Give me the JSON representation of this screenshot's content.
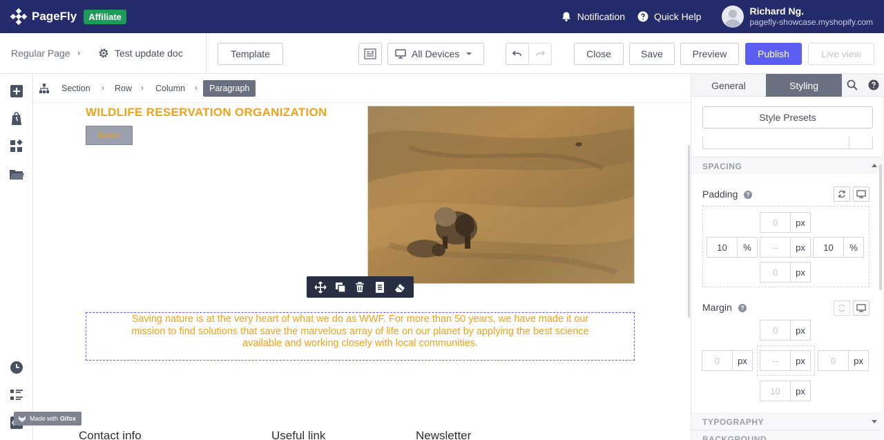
{
  "topbar": {
    "brand": "PageFly",
    "badge": "Affiliate",
    "notification_label": "Notification",
    "help_label": "Quick Help",
    "user_name": "Richard Ng.",
    "user_shop": "pagefly-showcase.myshopify.com",
    "bg_color": "#242b6a"
  },
  "toolbar": {
    "page_type": "Regular Page",
    "page_name": "Test update doc",
    "template_label": "Template",
    "device_label": "All Devices",
    "close_label": "Close",
    "save_label": "Save",
    "preview_label": "Preview",
    "publish_label": "Publish",
    "live_view_label": "Live view",
    "accent_color": "#5b5ef0"
  },
  "breadcrumb": {
    "items": [
      "Section",
      "Row",
      "Column"
    ],
    "active": "Paragraph"
  },
  "canvas": {
    "headline": "WILDLIFE RESERVATION ORGANIZATION",
    "button_label": "Button",
    "paragraph": "Saving nature is at the very heart of what we do as WWF. For more than 50 years, we have made it our mission to find solutions that save the marvelous array of life on our planet by applying the best science available and working closely with local communities.",
    "footer_col_1": "Contact info",
    "footer_col_2": "Useful link",
    "footer_col_3": "Newsletter",
    "text_color": "#f0a21b",
    "watermark_prefix": "Made with",
    "watermark_brand": "Gifox"
  },
  "panel": {
    "tab_general": "General",
    "tab_styling": "Styling",
    "style_presets_label": "Style Presets",
    "spacing_title": "SPACING",
    "padding_label": "Padding",
    "margin_label": "Margin",
    "typography_title": "TYPOGRAPHY",
    "background_title": "BACKGROUND",
    "help_glyph": "?",
    "padding": {
      "top": {
        "value": "0",
        "unit": "px"
      },
      "left": {
        "value": "10",
        "unit": "%"
      },
      "center": {
        "value": "--",
        "unit": "px"
      },
      "right": {
        "value": "10",
        "unit": "%"
      },
      "bottom": {
        "value": "0",
        "unit": "px"
      }
    },
    "margin": {
      "top": {
        "value": "0",
        "unit": "px"
      },
      "left": {
        "value": "0",
        "unit": "px"
      },
      "center": {
        "value": "--",
        "unit": "px"
      },
      "right": {
        "value": "0",
        "unit": "px"
      },
      "bottom": {
        "value": "10",
        "unit": "px"
      }
    }
  }
}
